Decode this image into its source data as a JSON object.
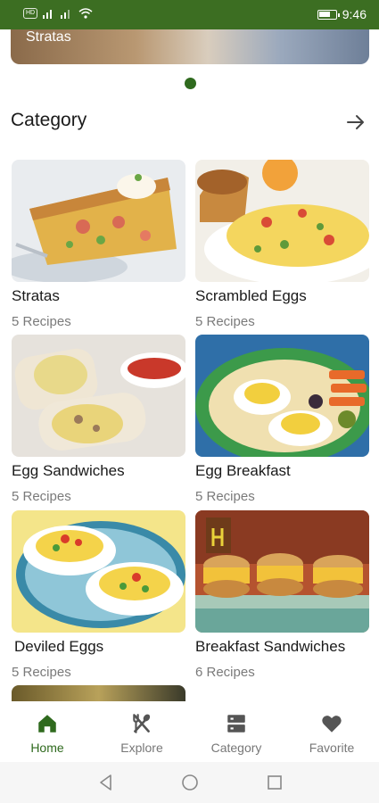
{
  "status_bar": {
    "network_label": "HD",
    "battery_level": 0.7,
    "time": "9:46"
  },
  "banner": {
    "label": "Stratas",
    "active_page": 1
  },
  "section": {
    "title": "Category"
  },
  "categories": [
    {
      "title": "Stratas",
      "count": "5 Recipes"
    },
    {
      "title": "Scrambled Eggs",
      "count": "5 Recipes"
    },
    {
      "title": "Egg Sandwiches",
      "count": "5 Recipes"
    },
    {
      "title": "Egg Breakfast",
      "count": "5 Recipes"
    },
    {
      "title": "Deviled Eggs",
      "count": "5 Recipes"
    },
    {
      "title": "Breakfast Sandwiches",
      "count": "6 Recipes"
    }
  ],
  "bottom_nav": [
    {
      "label": "Home",
      "icon": "home-icon",
      "active": true
    },
    {
      "label": "Explore",
      "icon": "fork-spoon-icon",
      "active": false
    },
    {
      "label": "Category",
      "icon": "category-list-icon",
      "active": false
    },
    {
      "label": "Favorite",
      "icon": "heart-icon",
      "active": false
    }
  ],
  "colors": {
    "primary": "#3c6e22",
    "accent": "#2f6a1e",
    "text": "#1a1a1a",
    "muted": "#7a7a7a"
  }
}
